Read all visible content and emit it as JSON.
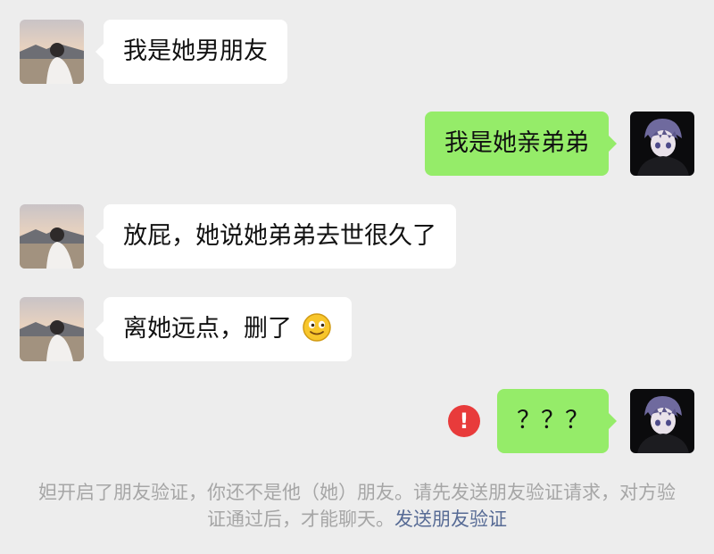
{
  "colors": {
    "background": "#ededed",
    "incoming_bubble": "#ffffff",
    "outgoing_bubble": "#95ec69",
    "error": "#e83b3b",
    "link": "#576b95",
    "notice_text": "#a6a6a6"
  },
  "messages": [
    {
      "side": "left",
      "avatar": "girl-photo-avatar",
      "text": "我是她男朋友"
    },
    {
      "side": "right",
      "avatar": "anime-boy-avatar",
      "text": "我是她亲弟弟"
    },
    {
      "side": "left",
      "avatar": "girl-photo-avatar",
      "text": "放屁，她说她弟弟去世很久了"
    },
    {
      "side": "left",
      "avatar": "girl-photo-avatar",
      "text": "离她远点，删了",
      "emoji": "smile-emoji"
    },
    {
      "side": "right",
      "avatar": "anime-boy-avatar",
      "text": "？？？",
      "status": "send-failed-icon"
    }
  ],
  "error_icon_text": "!",
  "notice": {
    "text": "妲开启了朋友验证，你还不是他（她）朋友。请先发送朋友验证请求，对方验证通过后，才能聊天。",
    "link": "发送朋友验证"
  }
}
